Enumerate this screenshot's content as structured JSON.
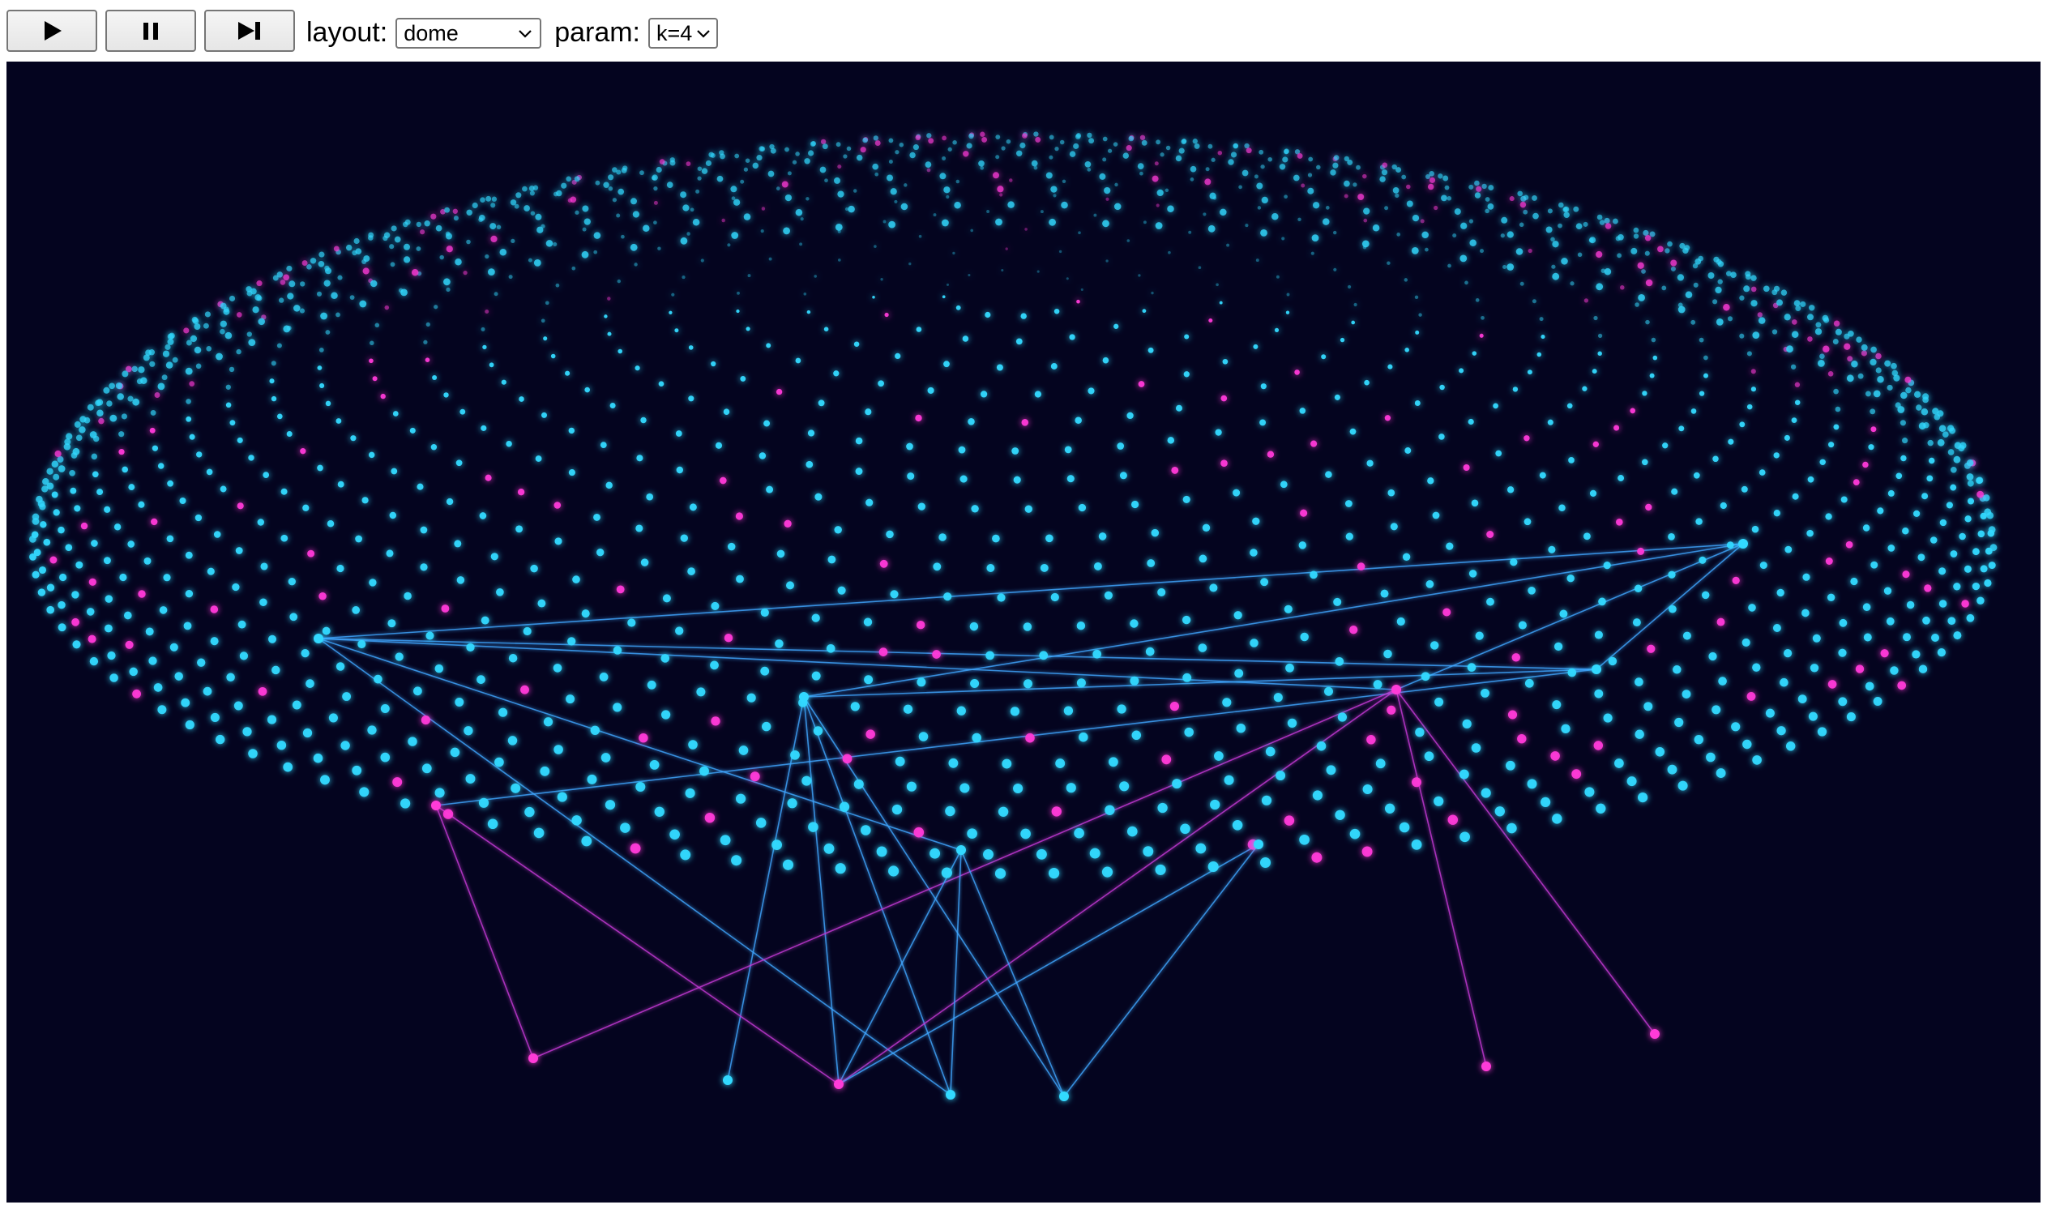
{
  "controls": {
    "play": {
      "icon": "play-icon"
    },
    "pause": {
      "icon": "pause-icon"
    },
    "step": {
      "icon": "step-forward-icon"
    }
  },
  "layout": {
    "label": "layout:",
    "value": "dome"
  },
  "param": {
    "label": "param:",
    "value": "k=4"
  },
  "colors": {
    "background": "#04041f",
    "node_cyan": "#32d9ff",
    "node_magenta": "#ff3ad8",
    "edge_blue": "#3fa6ff",
    "edge_magenta": "#c63ad6"
  }
}
